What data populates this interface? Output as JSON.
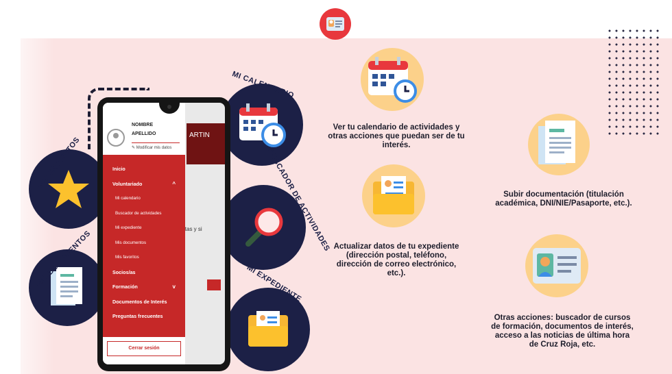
{
  "colors": {
    "red": "#c62828",
    "navy": "#1c2046",
    "pink_bg": "#fbe3e3",
    "yellow": "#fcd18a"
  },
  "circles": [
    {
      "label": "MI CALENDARIO",
      "icon": "calendar-icon"
    },
    {
      "label": "MIS FAVORITOS",
      "icon": "star-icon"
    },
    {
      "label": "BUSCADOR DE ACTIVIDADES",
      "icon": "magnifier-icon"
    },
    {
      "label": "MIS DOCUMENTOS",
      "icon": "document-icon"
    },
    {
      "label": "MI EXPEDIENTE",
      "icon": "folder-icon"
    }
  ],
  "phone": {
    "user_line1": "NOMBRE",
    "user_line2": "APELLIDO",
    "edit_label": "Modificar mis datos",
    "bg_header_text": "ARTIN",
    "bg_fragment": "sitas y si",
    "menu": [
      {
        "label": "Inicio"
      },
      {
        "label": "Voluntariado",
        "chevron": "^"
      },
      {
        "label": "Mi calendario"
      },
      {
        "label": "Buscador de actividades"
      },
      {
        "label": "Mi expediente"
      },
      {
        "label": "Mis documentos"
      },
      {
        "label": "Mis favoritos"
      },
      {
        "label": "Socios/as"
      },
      {
        "label": "Formación",
        "chevron": "v"
      },
      {
        "label": "Documentos de Interés"
      },
      {
        "label": "Preguntas frecuentes"
      }
    ],
    "logout_label": "Cerrar sesión"
  },
  "features": {
    "calendar": "Ver tu calendario de actividades y otras acciones que puedan ser de tu interés.",
    "expediente": "Actualizar datos de tu expediente (dirección postal, teléfono, dirección de correo electrónico, etc.).",
    "documentacion": "Subir documentación (titulación académica, DNI/NIE/Pasaporte, etc.).",
    "otras": "Otras acciones: buscador de cursos de formación, documentos de interés, acceso a las noticias de última hora de Cruz Roja, etc."
  }
}
